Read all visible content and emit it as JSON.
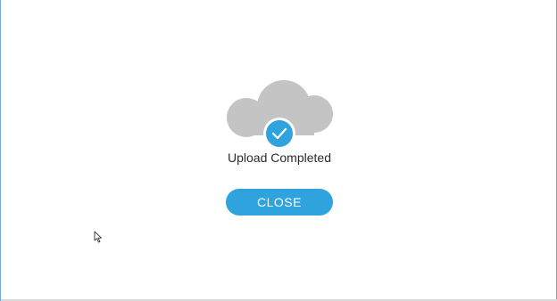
{
  "dialog": {
    "status_text": "Upload Completed",
    "close_label": "CLOSE",
    "icon": "cloud-check-icon"
  },
  "colors": {
    "accent": "#2ea3de",
    "cloud": "#c4c4c4",
    "window_border": "#6fa7d8"
  }
}
